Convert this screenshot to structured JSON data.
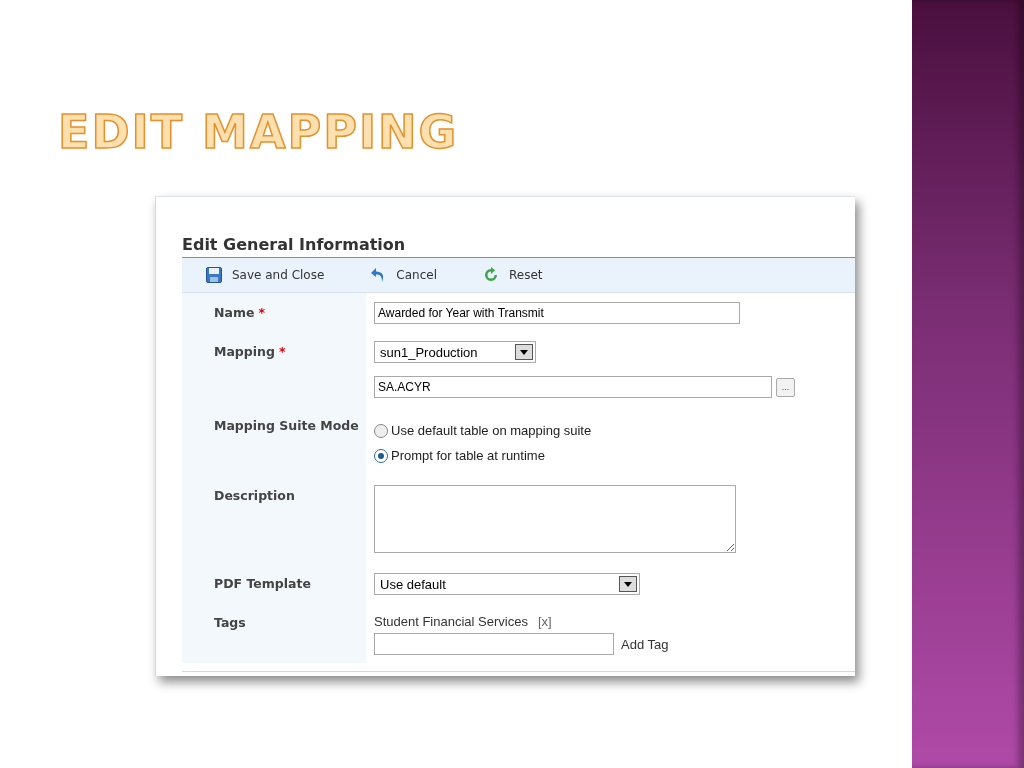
{
  "slide": {
    "title": "EDIT MAPPING"
  },
  "panel": {
    "title": "Edit General Information",
    "toolbar": [
      {
        "kind": "save",
        "label": "Save and Close"
      },
      {
        "kind": "cancel",
        "label": "Cancel"
      },
      {
        "kind": "reset",
        "label": "Reset"
      }
    ],
    "fields": [
      {
        "kind": "text",
        "label": "Name",
        "required_mark": "*",
        "value": "Awarded for Year with Transmit"
      },
      {
        "kind": "mapping",
        "label": "Mapping",
        "required_mark": "*",
        "value": "sun1_Production",
        "table": "SA.ACYR",
        "lookup": "..."
      },
      {
        "kind": "radio",
        "label": "Mapping Suite Mode",
        "options": [
          {
            "label": "Use default table on mapping suite",
            "selected": false
          },
          {
            "label": "Prompt for table at runtime",
            "selected": true
          }
        ]
      },
      {
        "kind": "textarea",
        "label": "Description"
      },
      {
        "kind": "select",
        "label": "PDF Template",
        "value": "Use default"
      },
      {
        "kind": "tags",
        "label": "Tags",
        "tags": [
          {
            "label": "Student Financial Services",
            "remove": "[x]"
          }
        ],
        "add_label": "Add Tag"
      }
    ]
  }
}
